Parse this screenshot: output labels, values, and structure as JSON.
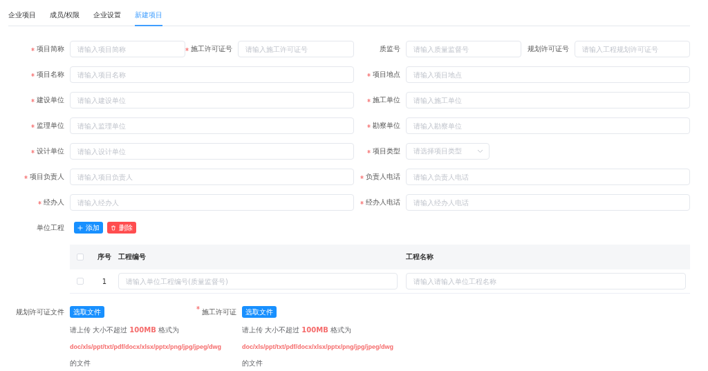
{
  "tabs": [
    {
      "label": "企业项目",
      "selected": false
    },
    {
      "label": "成员/权限",
      "selected": false
    },
    {
      "label": "企业设置",
      "selected": false
    },
    {
      "label": "新建项目",
      "selected": true
    }
  ],
  "form": {
    "rows": [
      {
        "fields": [
          {
            "label": "项目简称",
            "required": true,
            "placeholder": "请输入项目简称",
            "kind": "input"
          },
          {
            "label": "施工许可证号",
            "required": true,
            "placeholder": "请输入施工许可证号",
            "kind": "input"
          },
          {
            "label": "质监号",
            "required": false,
            "placeholder": "请输入质量监督号",
            "kind": "input"
          },
          {
            "label": "规划许可证号",
            "required": false,
            "placeholder": "请输入工程规划许可证号",
            "kind": "input"
          }
        ]
      },
      {
        "fields": [
          {
            "label": "项目名称",
            "required": true,
            "placeholder": "请输入项目名称",
            "kind": "input"
          },
          {
            "label": "项目地点",
            "required": true,
            "placeholder": "请输入项目地点",
            "kind": "input"
          }
        ]
      },
      {
        "fields": [
          {
            "label": "建设单位",
            "required": true,
            "placeholder": "请输入建设单位",
            "kind": "input"
          },
          {
            "label": "施工单位",
            "required": true,
            "placeholder": "请输入施工单位",
            "kind": "input"
          }
        ]
      },
      {
        "fields": [
          {
            "label": "监理单位",
            "required": true,
            "placeholder": "请输入监理单位",
            "kind": "input"
          },
          {
            "label": "勘察单位",
            "required": true,
            "placeholder": "请输入勘察单位",
            "kind": "input"
          }
        ]
      },
      {
        "fields": [
          {
            "label": "设计单位",
            "required": true,
            "placeholder": "请输入设计单位",
            "kind": "input"
          },
          {
            "label": "项目类型",
            "required": true,
            "placeholder": "请选择项目类型",
            "kind": "select"
          }
        ]
      },
      {
        "fields": [
          {
            "label": "项目负责人",
            "required": true,
            "placeholder": "请输入项目负责人",
            "kind": "input"
          },
          {
            "label": "负责人电话",
            "required": true,
            "placeholder": "请输入负责人电话",
            "kind": "input"
          }
        ]
      },
      {
        "fields": [
          {
            "label": "经办人",
            "required": true,
            "placeholder": "请输入经办人",
            "kind": "input"
          },
          {
            "label": "经办人电话",
            "required": true,
            "placeholder": "请输入经办人电话",
            "kind": "input"
          }
        ]
      }
    ]
  },
  "unit_project": {
    "label": "单位工程",
    "buttons": [
      {
        "label": "添加",
        "kind": "add"
      },
      {
        "label": "删除",
        "kind": "delete"
      }
    ],
    "table": {
      "select_all": {
        "checked": false
      },
      "columns": [
        "序号",
        "工程编号",
        "工程名称"
      ],
      "rows": [
        {
          "checked": false,
          "index": "1",
          "number_placeholder": "请输入单位工程编号(质量监督号)",
          "name_placeholder": "请输入请输入单位工程名称"
        }
      ]
    }
  },
  "uploads": [
    {
      "label": "规划许可证文件",
      "required": false,
      "button": "选取文件",
      "hint": "请上传 大小不超过 **100MB** 格式为",
      "formats": "doc/xls/ppt/txt/pdf/docx/xlsx/pptx/png/jpg/jpeg/dwg",
      "suffix": "的文件"
    },
    {
      "label": "施工许可证",
      "required": true,
      "button": "选取文件",
      "hint": "请上传 大小不超过 **100MB** 格式为",
      "formats": "doc/xls/ppt/txt/pdf/docx/xlsx/pptx/png/jpg/jpeg/dwg",
      "suffix": "的文件"
    }
  ]
}
